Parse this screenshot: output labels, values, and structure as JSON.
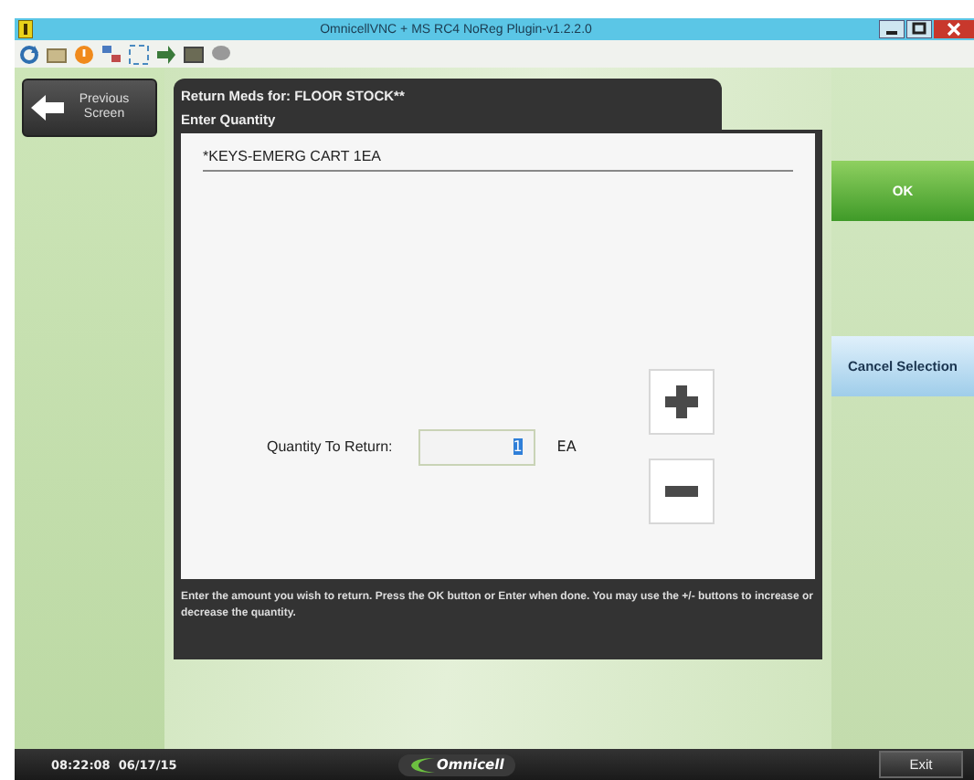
{
  "window": {
    "title": "OmnicellVNC  + MS RC4 NoReg Plugin-v1.2.2.0"
  },
  "nav": {
    "previous_button": "Previous Screen"
  },
  "dialog": {
    "heading": "Return Meds for: FLOOR STOCK**",
    "subheading": "Enter Quantity",
    "item": "*KEYS-EMERG CART 1EA",
    "quantity_label": "Quantity To Return:",
    "quantity": {
      "value": "1",
      "highlighted": true
    },
    "unit": "EA",
    "instructions": "Enter the amount you wish to return. Press the OK button or Enter when done. You may use the +/- buttons to increase or decrease the quantity."
  },
  "actions": [
    {
      "label": "OK",
      "kind": "confirm"
    },
    {
      "label": "Cancel Selection",
      "kind": "cancel"
    }
  ],
  "status_bar": {
    "time": "08:22:08  06/17/15",
    "logo": "Omnicell",
    "exit_button": "Exit"
  }
}
